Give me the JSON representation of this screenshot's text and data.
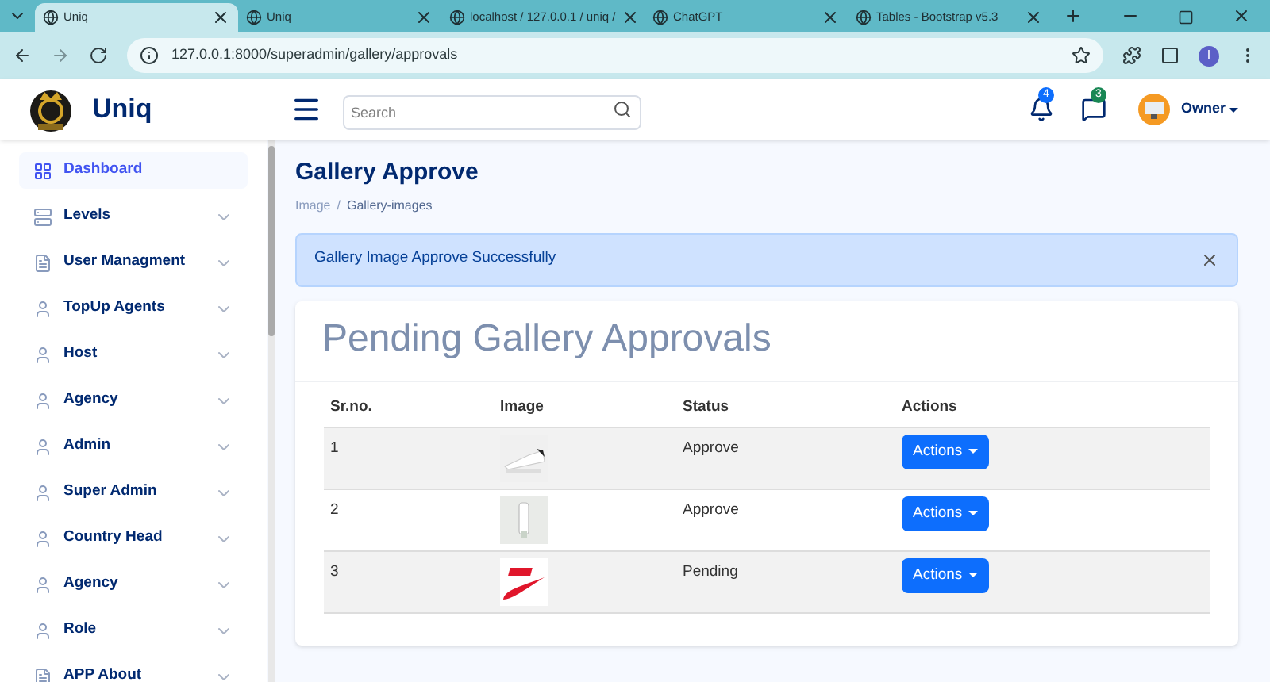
{
  "browser": {
    "tabs": [
      {
        "title": "Uniq",
        "selected": true
      },
      {
        "title": "Uniq",
        "selected": false
      },
      {
        "title": "localhost / 127.0.0.1 / uniq /",
        "selected": false
      },
      {
        "title": "ChatGPT",
        "selected": false
      },
      {
        "title": "Tables - Bootstrap v5.3",
        "selected": false
      }
    ],
    "url": "127.0.0.1:8000/superadmin/gallery/approvals",
    "profile_initial": "I"
  },
  "header": {
    "brand": "Uniq",
    "search": {
      "placeholder": "Search"
    },
    "notifications": "4",
    "messages": "3",
    "user": "Owner"
  },
  "sidebar": {
    "items": [
      {
        "label": "Dashboard",
        "selected": true,
        "kind": "grid"
      },
      {
        "label": "Levels",
        "selected": false,
        "kind": "list"
      },
      {
        "label": "User Managment",
        "selected": false,
        "kind": "doc"
      },
      {
        "label": "TopUp Agents",
        "selected": false,
        "kind": "person"
      },
      {
        "label": "Host",
        "selected": false,
        "kind": "person"
      },
      {
        "label": "Agency",
        "selected": false,
        "kind": "person"
      },
      {
        "label": "Admin",
        "selected": false,
        "kind": "person"
      },
      {
        "label": "Super Admin",
        "selected": false,
        "kind": "person"
      },
      {
        "label": "Country Head",
        "selected": false,
        "kind": "person"
      },
      {
        "label": "Agency",
        "selected": false,
        "kind": "person"
      },
      {
        "label": "Role",
        "selected": false,
        "kind": "person"
      },
      {
        "label": "APP About",
        "selected": false,
        "kind": "doc"
      }
    ]
  },
  "page": {
    "title": "Gallery Approve",
    "breadcrumb": [
      "Image",
      "/",
      "Gallery-images"
    ],
    "alert": "Gallery Image Approve Successfully"
  },
  "card": {
    "title": "Pending Gallery Approvals",
    "table": {
      "columns": [
        "Sr.no.",
        "Image",
        "Status",
        "Actions"
      ],
      "rows": [
        {
          "sr": "1",
          "status": "Approve",
          "action": "Actions"
        },
        {
          "sr": "2",
          "status": "Approve",
          "action": "Actions"
        },
        {
          "sr": "3",
          "status": "Pending",
          "action": "Actions"
        }
      ]
    }
  }
}
